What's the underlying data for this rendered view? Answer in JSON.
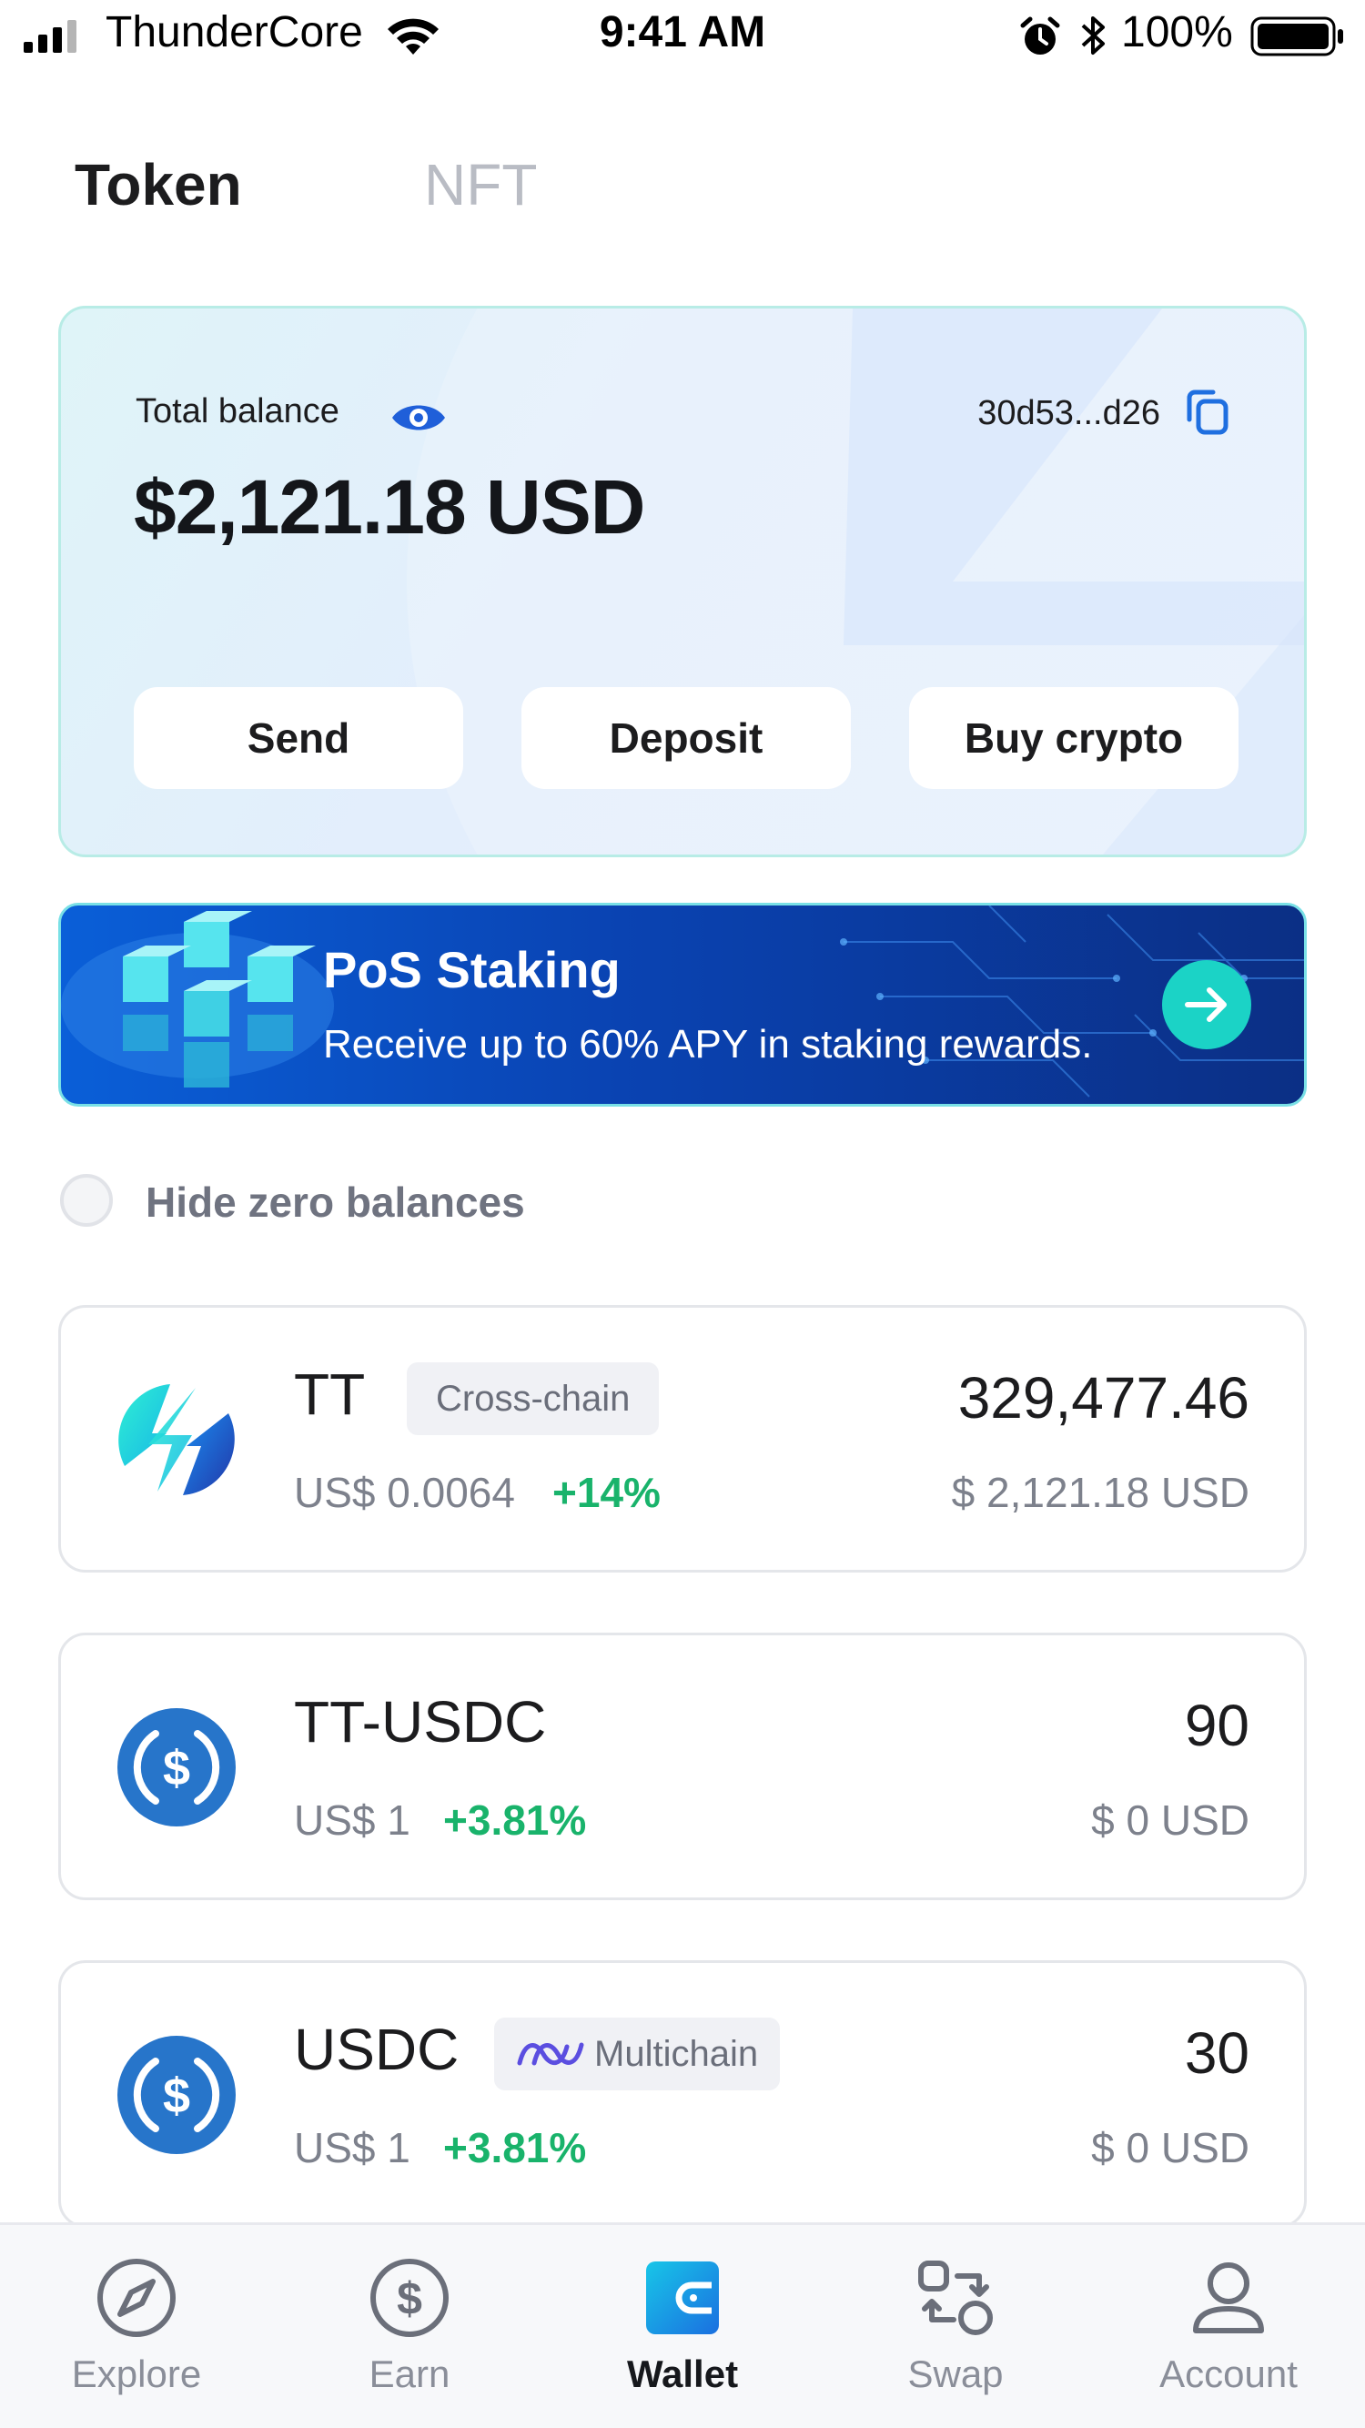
{
  "status_bar": {
    "carrier": "ThunderCore",
    "time": "9:41 AM",
    "battery": "100%"
  },
  "tabs": [
    {
      "label": "Token",
      "active": true
    },
    {
      "label": "NFT",
      "active": false
    }
  ],
  "balance_card": {
    "label": "Total balance",
    "amount": "$2,121.18 USD",
    "address": "30d53...d26",
    "buttons": {
      "send": "Send",
      "deposit": "Deposit",
      "buy": "Buy crypto"
    }
  },
  "staking_banner": {
    "title": "PoS Staking",
    "subtitle": "Receive up to 60% APY in staking rewards."
  },
  "hide_zero": {
    "label": "Hide zero balances",
    "checked": false
  },
  "tokens": [
    {
      "name": "TT",
      "badge": "Cross-chain",
      "price": "US$ 0.0064",
      "change": "+14%",
      "amount": "329,477.46",
      "usd_value": "$ 2,121.18 USD",
      "icon": "thundercore-logo-icon"
    },
    {
      "name": "TT-USDC",
      "badge": "",
      "price": "US$ 1",
      "change": "+3.81%",
      "amount": "90",
      "usd_value": "$ 0 USD",
      "icon": "usdc-logo-icon"
    },
    {
      "name": "USDC",
      "badge": "Multichain",
      "price": "US$ 1",
      "change": "+3.81%",
      "amount": "30",
      "usd_value": "$ 0 USD",
      "icon": "usdc-logo-icon"
    }
  ],
  "bottom_nav": [
    {
      "label": "Explore",
      "icon": "compass-icon",
      "active": false
    },
    {
      "label": "Earn",
      "icon": "dollar-circle-icon",
      "active": false
    },
    {
      "label": "Wallet",
      "icon": "wallet-icon",
      "active": true
    },
    {
      "label": "Swap",
      "icon": "swap-icon",
      "active": false
    },
    {
      "label": "Account",
      "icon": "user-icon",
      "active": false
    }
  ],
  "colors": {
    "accent_blue": "#1f6fe0",
    "positive_green": "#19b36b",
    "muted_text": "#7d818c",
    "brand_teal": "#1bd3c6"
  }
}
